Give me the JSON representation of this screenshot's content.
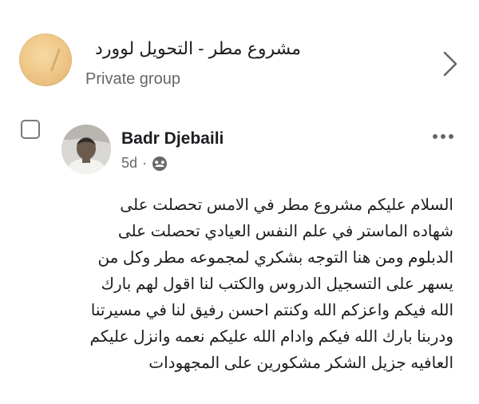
{
  "group": {
    "name": "مشروع مطر - التحويل لوورد",
    "type": "Private group",
    "avatar_icon": "group-cover-icon",
    "chevron_icon": "chevron-right-icon"
  },
  "post": {
    "author": "Badr Djebaili",
    "time": "5d",
    "separator": "·",
    "privacy_icon": "group-members-icon",
    "more_icon": "more-horizontal-icon",
    "select_icon": "checkbox-icon",
    "lines": [
      "السلام عليكم مشروع مطر في الامس تحصلت على",
      "شهاده الماستر في علم النفس العيادي تحصلت على",
      "الدبلوم ومن هنا التوجه بشكري لمجموعه مطر وكل من",
      "يسهر على التسجيل الدروس والكتب لنا اقول لهم بارك",
      "الله فيكم واعزكم الله وكنتم احسن رفيق لنا في مسيرتنا",
      "ودربنا بارك الله فيكم وادام الله عليكم نعمه وانزل عليكم",
      "العافيه جزيل الشكر مشكورين على المجهودات"
    ]
  },
  "colors": {
    "text": "#1c1e21",
    "secondary": "#65676b",
    "background": "#ffffff"
  }
}
